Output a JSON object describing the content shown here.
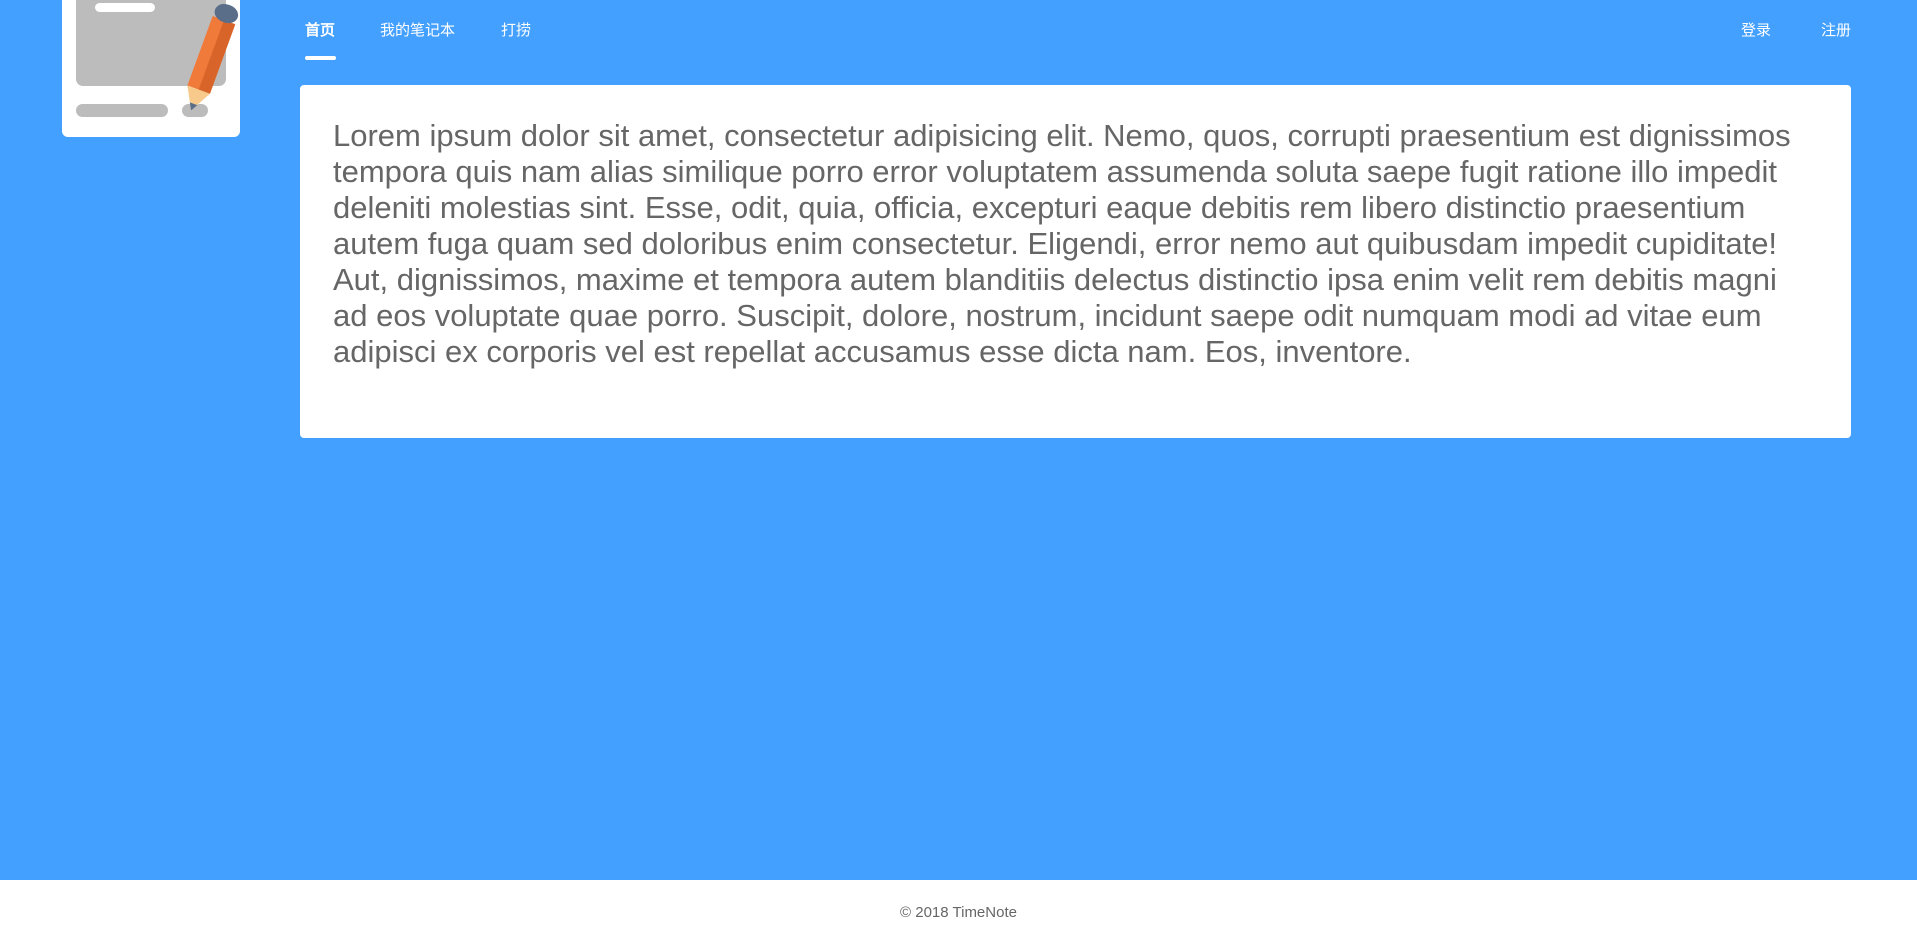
{
  "logo": {
    "icon": "notebook-pencil-icon",
    "colors": {
      "card": "#ffffff",
      "page": "#bcbcbc",
      "pencil_body": "#f07a3a",
      "pencil_shade": "#d9642a",
      "pencil_cap": "#5a6e8a",
      "pencil_tip": "#f7c98b"
    }
  },
  "nav": {
    "left": [
      {
        "label": "首页",
        "active": true
      },
      {
        "label": "我的笔记本",
        "active": false
      },
      {
        "label": "打捞",
        "active": false
      }
    ],
    "right": [
      {
        "label": "登录"
      },
      {
        "label": "注册"
      }
    ]
  },
  "content": {
    "text": "Lorem ipsum dolor sit amet, consectetur adipisicing elit. Nemo, quos, corrupti praesentium est dignissimos tempora quis nam alias similique porro error voluptatem assumenda soluta saepe fugit ratione illo impedit deleniti molestias sint. Esse, odit, quia, officia, excepturi eaque debitis rem libero distinctio praesentium autem fuga quam sed doloribus enim consectetur. Eligendi, error nemo aut quibusdam impedit cupiditate! Aut, dignissimos, maxime et tempora autem blanditiis delectus distinctio ipsa enim velit rem debitis magni ad eos voluptate quae porro. Suscipit, dolore, nostrum, incidunt saepe odit numquam modi ad vitae eum adipisci ex corporis vel est repellat accusamus esse dicta nam. Eos, inventore."
  },
  "footer": {
    "text": "© 2018 TimeNote"
  },
  "colors": {
    "background": "#43a0ff",
    "card": "#ffffff",
    "text": "#666666",
    "nav_text": "#ffffff"
  }
}
